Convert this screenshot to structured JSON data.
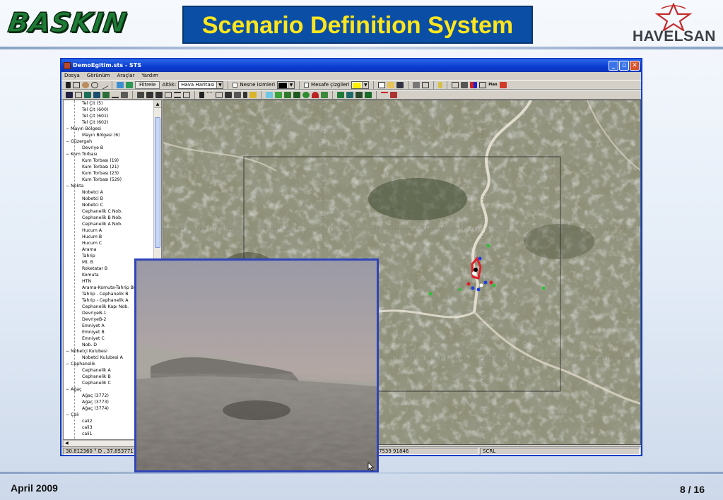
{
  "slide": {
    "title": "Scenario Definition System",
    "left_logo": "BASKIN",
    "right_logo": "HAVELSAN",
    "date": "April 2009",
    "page": "8 / 16"
  },
  "window": {
    "title": "DemoEgitim.sts - STS",
    "buttons": [
      "_",
      "▫",
      "✕"
    ]
  },
  "menu": [
    "Dosya",
    "Görünüm",
    "Araçlar",
    "Yardım"
  ],
  "toolbar1": {
    "filter_label": "Filtrele",
    "base_label": "Altlık:",
    "base_value": "Hava Haritası",
    "object_names_label": "Nesne isimleri",
    "distance_lines_label": "Mesafe çizgileri",
    "plan_label": "Plan",
    "object_names_color": "#000000",
    "distance_lines_color": "#ffee00"
  },
  "tree": [
    {
      "text": "Tel Çit (5)",
      "level": 2
    },
    {
      "text": "Tel Çit (600)",
      "level": 2
    },
    {
      "text": "Tel Çit (601)",
      "level": 2
    },
    {
      "text": "Tel Çit (602)",
      "level": 2
    },
    {
      "text": "−  Mayın Bölgesi",
      "level": 1
    },
    {
      "text": "Mayın Bölgesi (6)",
      "level": 2
    },
    {
      "text": "−  Güzergah",
      "level": 1
    },
    {
      "text": "Devriye B",
      "level": 2
    },
    {
      "text": "−  Kum Torbası",
      "level": 1
    },
    {
      "text": "Kum Torbası (19)",
      "level": 2
    },
    {
      "text": "Kum Torbası (21)",
      "level": 2
    },
    {
      "text": "Kum Torbası (23)",
      "level": 2
    },
    {
      "text": "Kum Torbası (529)",
      "level": 2
    },
    {
      "text": "−  Nokta",
      "level": 1
    },
    {
      "text": "Nobetci A",
      "level": 2
    },
    {
      "text": "Nobetci B",
      "level": 2
    },
    {
      "text": "Nobetci C",
      "level": 2
    },
    {
      "text": "Cephanelik C Nob.",
      "level": 2
    },
    {
      "text": "Cephanelik B Nob.",
      "level": 2
    },
    {
      "text": "Cephanelik A Nob.",
      "level": 2
    },
    {
      "text": "Hucum A",
      "level": 2
    },
    {
      "text": "Hucum B",
      "level": 2
    },
    {
      "text": "Hucum C",
      "level": 2
    },
    {
      "text": "Arama",
      "level": 2
    },
    {
      "text": "Tahrip",
      "level": 2
    },
    {
      "text": "Mt. B",
      "level": 2
    },
    {
      "text": "Roketatar B",
      "level": 2
    },
    {
      "text": "Komuta",
      "level": 2
    },
    {
      "text": "HTN",
      "level": 2
    },
    {
      "text": "Arama-Komuta-Tahrip Bu",
      "level": 2
    },
    {
      "text": "Tahrip - Cephanelik B",
      "level": 2
    },
    {
      "text": "Tahrip - Cephanelik A",
      "level": 2
    },
    {
      "text": "Cephanelik Kapı Nob.",
      "level": 2
    },
    {
      "text": "DevriyeB-1",
      "level": 2
    },
    {
      "text": "DevriyeB-2",
      "level": 2
    },
    {
      "text": "Emniyet A",
      "level": 2
    },
    {
      "text": "Emniyet B",
      "level": 2
    },
    {
      "text": "Emniyet C",
      "level": 2
    },
    {
      "text": "Nob. D",
      "level": 2
    },
    {
      "text": "−  Nöbetçi Kulubesi",
      "level": 1
    },
    {
      "text": "Nobetci Kulubesi A",
      "level": 2
    },
    {
      "text": "−  Cephanelik",
      "level": 1
    },
    {
      "text": "Cephanelik A",
      "level": 2
    },
    {
      "text": "Cephanelik B",
      "level": 2
    },
    {
      "text": "Cephanelik C",
      "level": 2
    },
    {
      "text": "−  Ağaç",
      "level": 1
    },
    {
      "text": "Ağaç (3772)",
      "level": 2
    },
    {
      "text": "Ağaç (3773)",
      "level": 2
    },
    {
      "text": "Ağaç (3774)",
      "level": 2
    },
    {
      "text": "−  Çalı",
      "level": 1
    },
    {
      "text": "cali2",
      "level": 2
    },
    {
      "text": "cali3",
      "level": 2
    },
    {
      "text": "cali1",
      "level": 2
    }
  ],
  "status": {
    "coords": "30.812360 ° D , 37.853771 ° K",
    "utm": "7539  91846",
    "mode": "SCRL"
  },
  "colors": {
    "title_bg": "#0a4fa5",
    "title_text": "#ffe61c",
    "window_border": "#0b3fc9",
    "marker_red": "#e0202a",
    "marker_blue": "#1d3fe0",
    "marker_green": "#2fbf3a"
  }
}
